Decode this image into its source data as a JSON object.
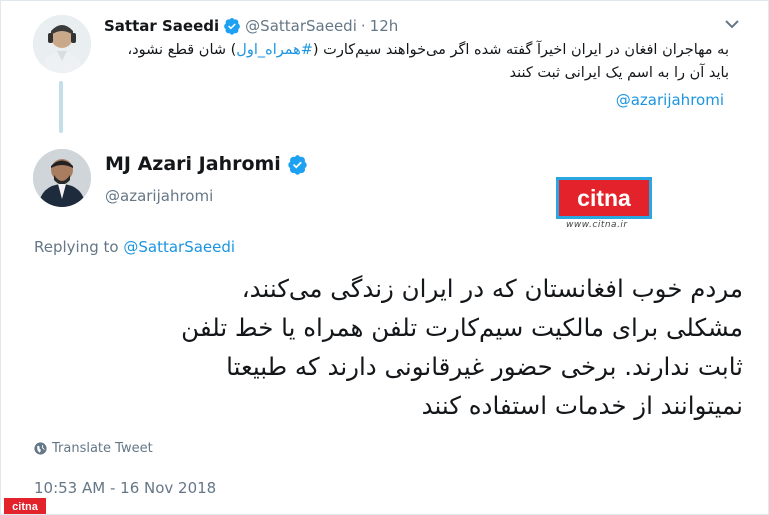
{
  "parent_tweet": {
    "name": "Sattar Saeedi",
    "handle": "@SattarSaeedi",
    "separator": "·",
    "time": "12h",
    "text_before_hashtag": "به مهاجران افغان در ایران اخیرآ گفته شده اگر می‌خواهند سیم‌کارت (",
    "hashtag": "#همراه_اول",
    "text_after_hashtag": ") شان قطع نشود، باید آن را به اسم یک ایرانی ثبت کنند",
    "mention": "@azarijahromi",
    "avatar_icon": "person-avatar-icon"
  },
  "main_tweet": {
    "name": "MJ Azari Jahromi",
    "handle": "@azarijahromi",
    "replying_prefix": "Replying to",
    "replying_to": "@SattarSaeedi",
    "text": "مردم خوب افغانستان که در ایران زندگی می‌کنند، مشکلی برای مالکیت سیم‌کارت تلفن همراه یا خط تلفن ثابت ندارند. برخی حضور غیرقانونی دارند که طبیعتا نمیتوانند از خدمات استفاده کنند",
    "translate_label": "Translate Tweet",
    "timestamp": "10:53 AM - 16 Nov 2018",
    "avatar_icon": "person-avatar-icon"
  },
  "watermark": {
    "logo_text": "citna",
    "url": "www.citna.ir",
    "footer_logo_text": "citna"
  },
  "colors": {
    "link": "#1b95e0",
    "muted": "#657786",
    "verified": "#1da1f2",
    "citna_red": "#e3222b",
    "citna_border": "#2aa7e0",
    "thread_line": "#c4dfe9"
  }
}
